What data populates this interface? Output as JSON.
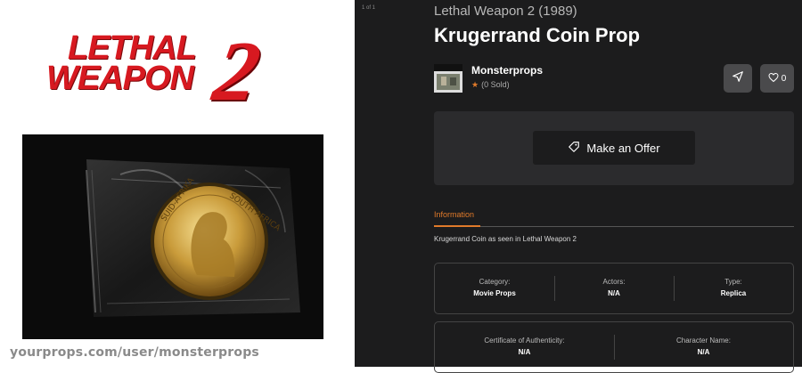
{
  "brand": {
    "logo_line1": "LETHAL",
    "logo_line2": "WEAPON",
    "logo_number": "2",
    "logo_color": "#d71920"
  },
  "watermark": "yourprops.com/user/monsterprops",
  "gallery": {
    "counter": "1 of 1"
  },
  "listing": {
    "subtitle": "Lethal Weapon 2 (1989)",
    "title": "Krugerrand Coin Prop",
    "seller_name": "Monsterprops",
    "seller_stats": "(0 Sold)",
    "like_count": "0",
    "offer_label": "Make an Offer",
    "tab_label": "Information",
    "description": "Krugerrand Coin as seen in Lethal Weapon 2"
  },
  "properties_row1": [
    {
      "label": "Category:",
      "value": "Movie Props"
    },
    {
      "label": "Actors:",
      "value": "N/A"
    },
    {
      "label": "Type:",
      "value": "Replica"
    }
  ],
  "properties_row2": [
    {
      "label": "Certificate of Authenticity:",
      "value": "N/A"
    },
    {
      "label": "Character Name:",
      "value": "N/A"
    }
  ],
  "colors": {
    "accent": "#e07a2a",
    "panel": "#1c1c1d",
    "card": "#2b2b2d"
  },
  "icons": [
    "send-icon",
    "heart-icon",
    "star-icon",
    "tag-offer-icon"
  ]
}
